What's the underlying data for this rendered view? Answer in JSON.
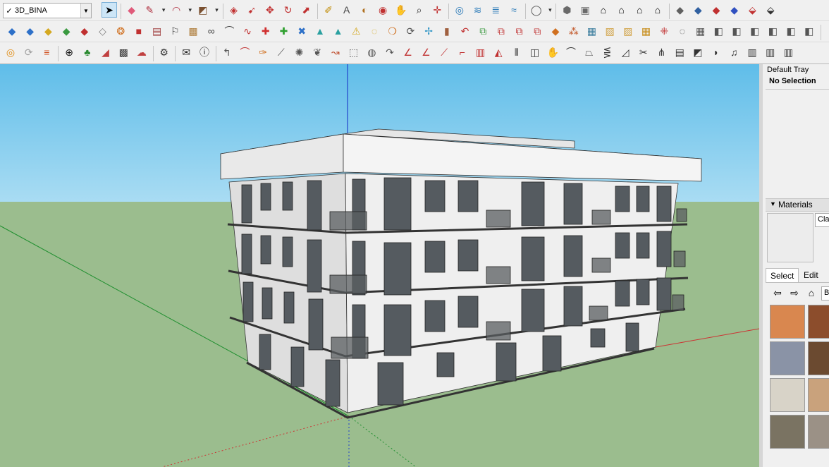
{
  "layers": {
    "current": "3D_BINA",
    "checked": "✓",
    "arrow": "▼"
  },
  "toolbar": {
    "row1": [
      {
        "name": "select-tool-icon",
        "glyph": "➤",
        "color": "#000000"
      },
      {
        "name": "eraser-icon",
        "glyph": "◆",
        "color": "#e05a7a"
      },
      {
        "name": "pencil-line-icon",
        "glyph": "✎",
        "color": "#b03040"
      },
      {
        "name": "dropdown-caret-icon",
        "glyph": "▾",
        "color": "#333333"
      },
      {
        "name": "arc-tool-icon",
        "glyph": "◠",
        "color": "#b03040"
      },
      {
        "name": "dropdown-caret-icon",
        "glyph": "▾",
        "color": "#333333"
      },
      {
        "name": "shape-tool-icon",
        "glyph": "◩",
        "color": "#7a5030"
      },
      {
        "name": "dropdown-caret-icon",
        "glyph": "▾",
        "color": "#333333"
      },
      {
        "name": "push-pull-icon",
        "glyph": "◈",
        "color": "#c03030"
      },
      {
        "name": "follow-me-icon",
        "glyph": "➹",
        "color": "#c03030"
      },
      {
        "name": "move-icon",
        "glyph": "✥",
        "color": "#c03030"
      },
      {
        "name": "rotate-icon",
        "glyph": "↻",
        "color": "#c03030"
      },
      {
        "name": "scale-icon",
        "glyph": "⬈",
        "color": "#c03030"
      },
      {
        "name": "tape-measure-icon",
        "glyph": "✐",
        "color": "#c08a00"
      },
      {
        "name": "text-label-icon",
        "glyph": "A",
        "color": "#444444"
      },
      {
        "name": "paint-bucket-icon",
        "glyph": "◐",
        "color": "#b07020"
      },
      {
        "name": "orbit-icon",
        "glyph": "◉",
        "color": "#c03030"
      },
      {
        "name": "pan-icon",
        "glyph": "✋",
        "color": "#c08a00"
      },
      {
        "name": "zoom-icon",
        "glyph": "⌕",
        "color": "#333333"
      },
      {
        "name": "zoom-extents-icon",
        "glyph": "✛",
        "color": "#c03030"
      },
      {
        "name": "warehouse-icon",
        "glyph": "◎",
        "color": "#2a7ab8"
      },
      {
        "name": "extension-icon",
        "glyph": "≋",
        "color": "#2a7ab8"
      },
      {
        "name": "layout-icon",
        "glyph": "≣",
        "color": "#2a7ab8"
      },
      {
        "name": "sandbox-icon",
        "glyph": "≈",
        "color": "#2a7ab8"
      },
      {
        "name": "account-icon",
        "glyph": "◯",
        "color": "#555555"
      },
      {
        "name": "dropdown-caret-icon",
        "glyph": "▾",
        "color": "#333333"
      },
      {
        "name": "iso-view-icon",
        "glyph": "⬢",
        "color": "#6a6a6a"
      },
      {
        "name": "top-view-icon",
        "glyph": "▣",
        "color": "#6a6a6a"
      },
      {
        "name": "front-view-icon",
        "glyph": "⌂",
        "color": "#000000"
      },
      {
        "name": "right-view-icon",
        "glyph": "⌂",
        "color": "#000000"
      },
      {
        "name": "back-view-icon",
        "glyph": "⌂",
        "color": "#000000"
      },
      {
        "name": "left-view-icon",
        "glyph": "⌂",
        "color": "#000000"
      },
      {
        "name": "xray-style-icon",
        "glyph": "◆",
        "color": "#606060"
      },
      {
        "name": "wireframe-style-icon",
        "glyph": "◆",
        "color": "#3060a0"
      },
      {
        "name": "shaded-style-icon",
        "glyph": "◆",
        "color": "#c03030"
      },
      {
        "name": "textured-style-icon",
        "glyph": "◆",
        "color": "#3050c0"
      },
      {
        "name": "section-plane-icon",
        "glyph": "⬙",
        "color": "#c03030"
      },
      {
        "name": "section-display-icon",
        "glyph": "⬙",
        "color": "#303030"
      }
    ],
    "row2": [
      {
        "name": "plugin-blue-tile-icon",
        "glyph": "◆",
        "color": "#2d70c8"
      },
      {
        "name": "plugin-blue-tile-icon",
        "glyph": "◆",
        "color": "#2d70c8"
      },
      {
        "name": "plugin-yellow-tile-icon",
        "glyph": "◆",
        "color": "#d4a820"
      },
      {
        "name": "plugin-green-tile-icon",
        "glyph": "◆",
        "color": "#3a9a40"
      },
      {
        "name": "plugin-red-tile-icon",
        "glyph": "◆",
        "color": "#c03030"
      },
      {
        "name": "plugin-grey-tile-icon",
        "glyph": "◇",
        "color": "#808080"
      },
      {
        "name": "plugin-orange-swirl-icon",
        "glyph": "❂",
        "color": "#d07020"
      },
      {
        "name": "plugin-red-square-icon",
        "glyph": "■",
        "color": "#c03030"
      },
      {
        "name": "plugin-grid-icon",
        "glyph": "▤",
        "color": "#a04040"
      },
      {
        "name": "plugin-flag-icon",
        "glyph": "⚐",
        "color": "#333333"
      },
      {
        "name": "plugin-box-icon",
        "glyph": "▩",
        "color": "#b08040"
      },
      {
        "name": "plugin-link-icon",
        "glyph": "∞",
        "color": "#444444"
      },
      {
        "name": "plugin-curve-icon",
        "glyph": "⌒",
        "color": "#444444"
      },
      {
        "name": "plugin-bezier-icon",
        "glyph": "∿",
        "color": "#c03030"
      },
      {
        "name": "plugin-red-cross-icon",
        "glyph": "✚",
        "color": "#d03030"
      },
      {
        "name": "plugin-green-cross-icon",
        "glyph": "✚",
        "color": "#30a030"
      },
      {
        "name": "plugin-blue-x-icon",
        "glyph": "✖",
        "color": "#2d70c8"
      },
      {
        "name": "plugin-cone-icon",
        "glyph": "▲",
        "color": "#2aa0a0"
      },
      {
        "name": "plugin-cone-alt-icon",
        "glyph": "▲",
        "color": "#2aa0a0"
      },
      {
        "name": "plugin-warning-icon",
        "glyph": "⚠",
        "color": "#d4a820"
      },
      {
        "name": "plugin-spiral-icon",
        "glyph": "◌",
        "color": "#d4a820"
      },
      {
        "name": "plugin-loop-icon",
        "glyph": "❍",
        "color": "#d07020"
      },
      {
        "name": "plugin-refresh-icon",
        "glyph": "⟳",
        "color": "#555555"
      },
      {
        "name": "plugin-move-icon",
        "glyph": "✢",
        "color": "#3a9ac8"
      },
      {
        "name": "plugin-cube-icon",
        "glyph": "▮",
        "color": "#a06040"
      },
      {
        "name": "plugin-undo-icon",
        "glyph": "↶",
        "color": "#c03030"
      },
      {
        "name": "plugin-component-icon",
        "glyph": "⧉",
        "color": "#3a9a40"
      },
      {
        "name": "plugin-component-alt-icon",
        "glyph": "⧉",
        "color": "#c03030"
      },
      {
        "name": "plugin-component-edit-icon",
        "glyph": "⧉",
        "color": "#c03030"
      },
      {
        "name": "plugin-component-swap-icon",
        "glyph": "⧉",
        "color": "#c03030"
      },
      {
        "name": "plugin-gem-icon",
        "glyph": "◆",
        "color": "#d07020"
      },
      {
        "name": "plugin-pattern-icon",
        "glyph": "⁂",
        "color": "#c05020"
      },
      {
        "name": "plugin-frame-icon",
        "glyph": "▦",
        "color": "#4080a0"
      },
      {
        "name": "plugin-hatch-icon",
        "glyph": "▨",
        "color": "#d0a040"
      },
      {
        "name": "plugin-hatch-alt-icon",
        "glyph": "▨",
        "color": "#d0a040"
      },
      {
        "name": "plugin-hatch-grid-icon",
        "glyph": "▦",
        "color": "#c89020"
      },
      {
        "name": "plugin-scatter-icon",
        "glyph": "⁜",
        "color": "#c03030"
      },
      {
        "name": "plugin-circle-dots-icon",
        "glyph": "◌",
        "color": "#444444"
      },
      {
        "name": "plugin-array-icon",
        "glyph": "▦",
        "color": "#555555"
      },
      {
        "name": "plugin-layers-icon",
        "glyph": "◧",
        "color": "#555555"
      },
      {
        "name": "plugin-stack-icon",
        "glyph": "◧",
        "color": "#555555"
      },
      {
        "name": "plugin-stack-alt-icon",
        "glyph": "◧",
        "color": "#555555"
      },
      {
        "name": "plugin-stack-add-icon",
        "glyph": "◧",
        "color": "#555555"
      },
      {
        "name": "plugin-stack-remove-icon",
        "glyph": "◧",
        "color": "#555555"
      },
      {
        "name": "plugin-stack-edit-icon",
        "glyph": "◧",
        "color": "#555555"
      }
    ],
    "row3": [
      {
        "name": "plugin-orange-logo-icon",
        "glyph": "◎",
        "color": "#e08a10"
      },
      {
        "name": "refresh-icon",
        "glyph": "⟳",
        "color": "#a0a0a0"
      },
      {
        "name": "plugin-stripes-icon",
        "glyph": "≡",
        "color": "#d05020"
      },
      {
        "name": "add-circle-icon",
        "glyph": "⊕",
        "color": "#111111"
      },
      {
        "name": "tree-icon",
        "glyph": "♣",
        "color": "#2a8a30"
      },
      {
        "name": "terrain-icon",
        "glyph": "◢",
        "color": "#c04040"
      },
      {
        "name": "checker-icon",
        "glyph": "▩",
        "color": "#333333"
      },
      {
        "name": "cloud-upload-icon",
        "glyph": "☁",
        "color": "#c04040"
      },
      {
        "name": "settings-gear-icon",
        "glyph": "⚙",
        "color": "#333333"
      },
      {
        "name": "email-icon",
        "glyph": "✉",
        "color": "#222222"
      },
      {
        "name": "info-icon",
        "glyph": "ⓘ",
        "color": "#222222"
      },
      {
        "name": "plugin-curve-tool-icon",
        "glyph": "↰",
        "color": "#555555"
      },
      {
        "name": "plugin-arc-tool-icon",
        "glyph": "⌒",
        "color": "#c03030"
      },
      {
        "name": "plugin-paint-icon",
        "glyph": "✑",
        "color": "#d07020"
      },
      {
        "name": "plugin-knife-icon",
        "glyph": "⟋",
        "color": "#555555"
      },
      {
        "name": "plugin-gear-shape-icon",
        "glyph": "✺",
        "color": "#555555"
      },
      {
        "name": "plugin-leaf-icon",
        "glyph": "❦",
        "color": "#555555"
      },
      {
        "name": "plugin-bend-icon",
        "glyph": "↝",
        "color": "#c05030"
      },
      {
        "name": "plugin-box-open-icon",
        "glyph": "⬚",
        "color": "#555555"
      },
      {
        "name": "plugin-sphere-icon",
        "glyph": "◍",
        "color": "#555555"
      },
      {
        "name": "plugin-sweep-icon",
        "glyph": "↷",
        "color": "#555555"
      },
      {
        "name": "plugin-angle-icon",
        "glyph": "∠",
        "color": "#c03030"
      },
      {
        "name": "plugin-angle-alt-icon",
        "glyph": "∠",
        "color": "#c03030"
      },
      {
        "name": "plugin-line-cut-icon",
        "glyph": "⟋",
        "color": "#c03030"
      },
      {
        "name": "plugin-hook-icon",
        "glyph": "⌐",
        "color": "#c03030"
      },
      {
        "name": "plugin-stair-icon",
        "glyph": "▥",
        "color": "#c03030"
      },
      {
        "name": "plugin-pyramid-icon",
        "glyph": "◭",
        "color": "#c03030"
      },
      {
        "name": "plugin-columns-icon",
        "glyph": "⦀",
        "color": "#333333"
      },
      {
        "name": "plugin-cylinder-icon",
        "glyph": "◫",
        "color": "#333333"
      },
      {
        "name": "plugin-hand-icon",
        "glyph": "✋",
        "color": "#333333"
      },
      {
        "name": "plugin-curve-line-icon",
        "glyph": "⌒",
        "color": "#333333"
      },
      {
        "name": "plugin-fold-icon",
        "glyph": "⏢",
        "color": "#333333"
      },
      {
        "name": "plugin-fan-icon",
        "glyph": "⋚",
        "color": "#333333"
      },
      {
        "name": "plugin-slope-icon",
        "glyph": "◿",
        "color": "#333333"
      },
      {
        "name": "plugin-scissor-icon",
        "glyph": "✂",
        "color": "#333333"
      },
      {
        "name": "plugin-split-icon",
        "glyph": "⋔",
        "color": "#333333"
      },
      {
        "name": "plugin-wall-icon",
        "glyph": "▤",
        "color": "#333333"
      },
      {
        "name": "plugin-ramp-icon",
        "glyph": "◩",
        "color": "#333333"
      },
      {
        "name": "plugin-vase-icon",
        "glyph": "◗",
        "color": "#333333"
      },
      {
        "name": "plugin-music-icon",
        "glyph": "♫",
        "color": "#333333"
      },
      {
        "name": "plugin-bars-icon",
        "glyph": "▥",
        "color": "#333333"
      },
      {
        "name": "plugin-bars-alt-icon",
        "glyph": "▥",
        "color": "#333333"
      },
      {
        "name": "plugin-bars-thick-icon",
        "glyph": "▥",
        "color": "#333333"
      }
    ]
  },
  "tray": {
    "title": "Default Tray",
    "selection": "No Selection",
    "materials": {
      "header": "Materials",
      "toggle": "▼",
      "name_value": "Classic",
      "tabs": [
        "Select",
        "Edit"
      ],
      "nav": {
        "back": "⇦",
        "forward": "⇨",
        "home": "⌂"
      },
      "library": "Brick, Cladding and Siding",
      "swatch_colors": [
        "#d9874f",
        "#8c4d2c",
        "#8a93a6",
        "#6b4a30",
        "#d8d3c8",
        "#c9a27c",
        "#7a7362",
        "#9b9186"
      ]
    }
  }
}
